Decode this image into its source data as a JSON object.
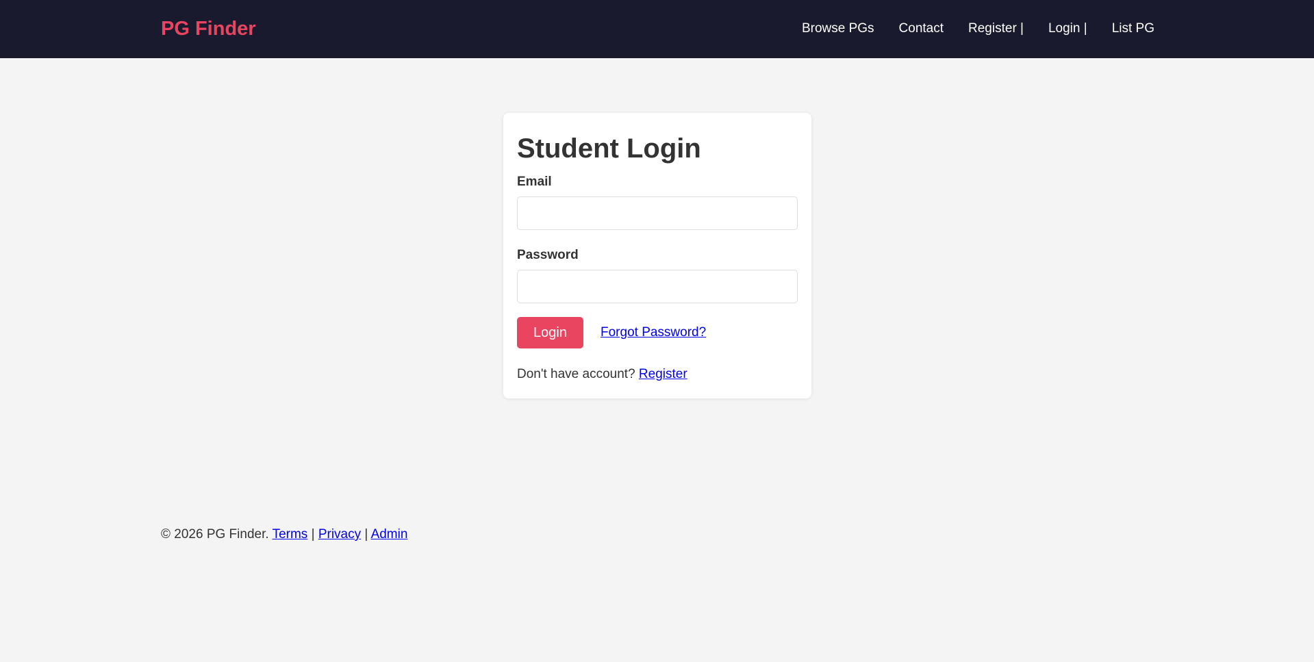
{
  "navbar": {
    "brand": "PG Finder",
    "links": [
      "Browse PGs",
      "Contact",
      "Register |",
      "Login |",
      "List PG"
    ]
  },
  "login_card": {
    "title": "Student Login",
    "email_label": "Email",
    "email_value": "",
    "password_label": "Password",
    "password_value": "",
    "login_button": "Login",
    "forgot_link": "Forgot Password?",
    "no_account_text": "Don't have account? ",
    "register_link": "Register"
  },
  "footer": {
    "copyright": "© 2026 PG Finder. ",
    "terms": "Terms",
    "sep1": " | ",
    "privacy": "Privacy",
    "sep2": " | ",
    "admin": "Admin"
  },
  "colors": {
    "navbar_bg": "#1a1a2e",
    "accent": "#e94560",
    "page_bg": "#f4f4f4",
    "link": "#0000ee"
  }
}
